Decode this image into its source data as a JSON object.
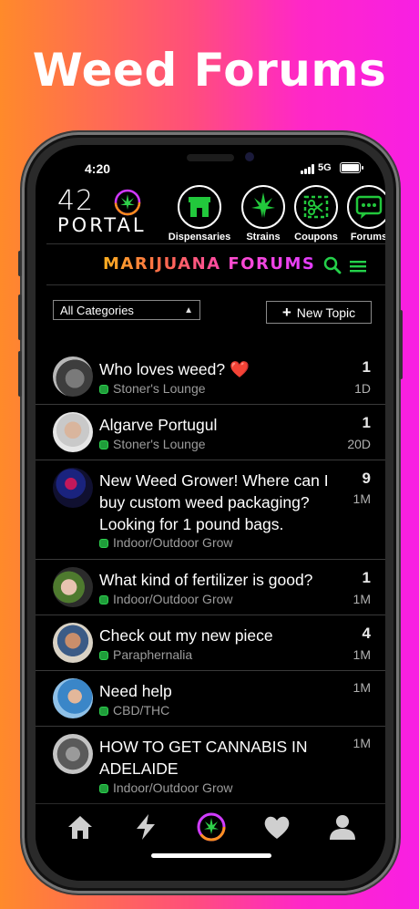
{
  "headline": "Weed Forums",
  "status_bar": {
    "time": "4:20",
    "network": "5G"
  },
  "logo": {
    "number": "42",
    "word": "PORTAL"
  },
  "categories": [
    {
      "label": "Dispensaries",
      "icon": "storefront-icon"
    },
    {
      "label": "Strains",
      "icon": "cannabis-leaf-icon"
    },
    {
      "label": "Coupons",
      "icon": "coupon-scissors-icon"
    },
    {
      "label": "Forums",
      "icon": "chat-bubble-icon"
    }
  ],
  "header": {
    "title_word1": "MARIJUANA",
    "title_word2": "FORUMS"
  },
  "filter": {
    "category_select": "All Categories",
    "new_topic_label": "New Topic"
  },
  "topics": [
    {
      "title": "Who loves weed? ❤️",
      "category": "Stoner's Lounge",
      "count": "1",
      "age": "1D",
      "avatar": "rocks"
    },
    {
      "title": "Algarve Portugul",
      "category": "Stoner's Lounge",
      "count": "1",
      "age": "20D",
      "avatar": "older-man"
    },
    {
      "title": "New Weed Grower! Where can I buy custom weed packaging? Looking for 1 pound bags.",
      "category": "Indoor/Outdoor Grow",
      "count": "9",
      "age": "1M",
      "avatar": "graphic"
    },
    {
      "title": "What kind of fertilizer is good?",
      "category": "Indoor/Outdoor Grow",
      "count": "1",
      "age": "1M",
      "avatar": "hands"
    },
    {
      "title": "Check out my new piece",
      "category": "Paraphernalia",
      "count": "4",
      "age": "1M",
      "avatar": "man-sunglasses"
    },
    {
      "title": "Need help",
      "category": "CBD/THC",
      "count": "",
      "age": "1M",
      "avatar": "woman-coast"
    },
    {
      "title": "HOW TO GET CANNABIS IN ADELAIDE",
      "category": "Indoor/Outdoor Grow",
      "count": "",
      "age": "1M",
      "avatar": "car"
    }
  ],
  "tabbar": [
    "home-icon",
    "bolt-icon",
    "cannabis-badge-icon",
    "heart-icon",
    "profile-icon"
  ],
  "colors": {
    "accent_green": "#1fbf3c",
    "gradient_left": "#ff8a2a",
    "gradient_right": "#f81fe3"
  }
}
